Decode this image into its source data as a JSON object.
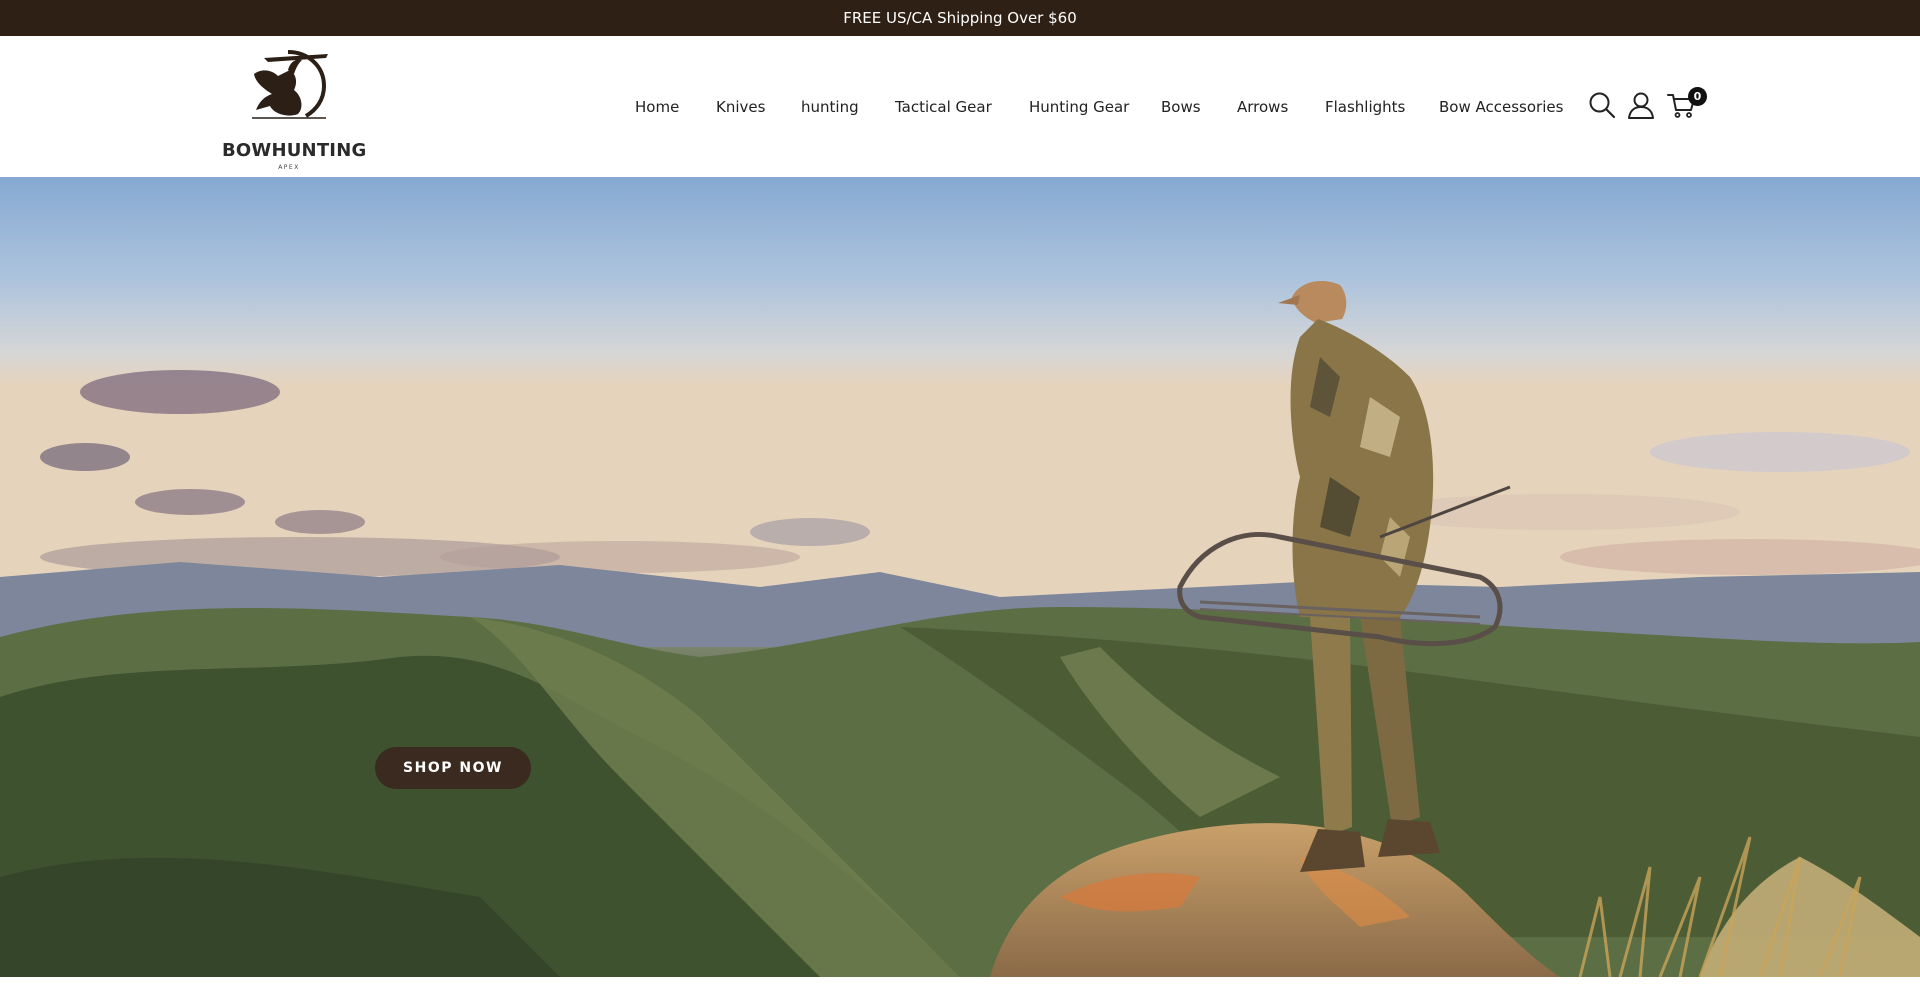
{
  "announcement": {
    "text": "FREE US/CA Shipping Over $60"
  },
  "brand": {
    "name": "BOWHUNTING",
    "tagline": "APEX"
  },
  "nav": {
    "items": [
      {
        "label": "Home"
      },
      {
        "label": "Knives"
      },
      {
        "label": "hunting"
      },
      {
        "label": "Tactical Gear"
      },
      {
        "label": "Hunting Gear"
      },
      {
        "label": "Bows"
      },
      {
        "label": "Arrows"
      },
      {
        "label": "Flashlights"
      },
      {
        "label": "Bow Accessories"
      }
    ]
  },
  "header_icons": {
    "search": "search-icon",
    "account": "user-icon",
    "cart": "cart-icon",
    "cart_count": "0"
  },
  "hero": {
    "button_label": "SHOP NOW",
    "image": "bowhunter standing on rocky outcrop over green mountain valley at sunset"
  },
  "colors": {
    "announcement_bg": "#2f2015",
    "button_bg": "#3a2a1f",
    "text": "#222222"
  }
}
